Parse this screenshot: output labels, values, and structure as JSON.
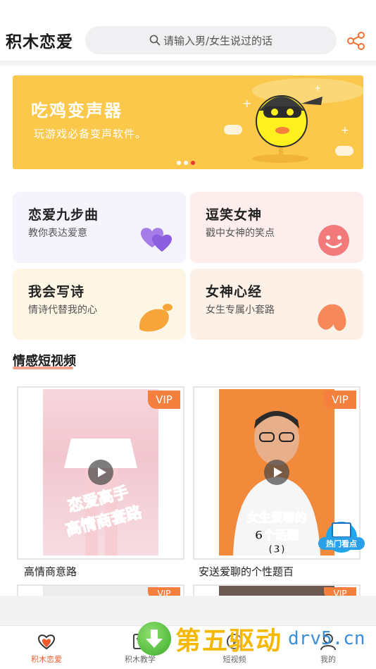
{
  "header": {
    "app_title": "积木恋爱",
    "search_placeholder": "请输入男/女生说过的话"
  },
  "banner": {
    "title": "吃鸡变声器",
    "subtitle": "玩游戏必备变声软件。",
    "slide_count": 3,
    "active_slide": 3
  },
  "features": [
    {
      "title": "恋爱九步曲",
      "subtitle": "教你表达爱意",
      "icon": "hearts-icon",
      "bg": "#f5f3fc"
    },
    {
      "title": "逗笑女神",
      "subtitle": "戳中女神的笑点",
      "icon": "smile-face-icon",
      "bg": "#fdeeed"
    },
    {
      "title": "我会写诗",
      "subtitle": "情诗代替我的心",
      "icon": "mango-icon",
      "bg": "#fdf6e4"
    },
    {
      "title": "女神心经",
      "subtitle": "女生专属小套路",
      "icon": "hair-icon",
      "bg": "#fdf1e7"
    }
  ],
  "section": {
    "title": "情感短视频"
  },
  "videos": [
    {
      "caption": "高情商意路",
      "vip": "VIP",
      "overlay_line1": "恋爱高手",
      "overlay_line2": "高情商套路"
    },
    {
      "caption": "安送爱聊的个性题百",
      "vip": "VIP",
      "overlay_line1": "女生爱聊的",
      "overlay_line2": "6个话题",
      "overlay_line3": "(3)",
      "badge": "热门看点"
    }
  ],
  "partial_vip": [
    "VIP",
    "VIP"
  ],
  "tabbar": [
    {
      "label": "积木恋爱",
      "icon": "heart-icon",
      "active": true
    },
    {
      "label": "积木教学",
      "icon": "book-icon",
      "active": false
    },
    {
      "label": "短视频",
      "icon": "play-icon",
      "active": false
    },
    {
      "label": "我的",
      "icon": "user-icon",
      "active": false
    }
  ],
  "watermark": {
    "text": "第五驱动",
    "domain": "drv5.cn"
  },
  "colors": {
    "accent": "#f05a2a",
    "banner": "#fbc84b",
    "vip": "#f57f3d",
    "underline": "#f4a08a"
  }
}
